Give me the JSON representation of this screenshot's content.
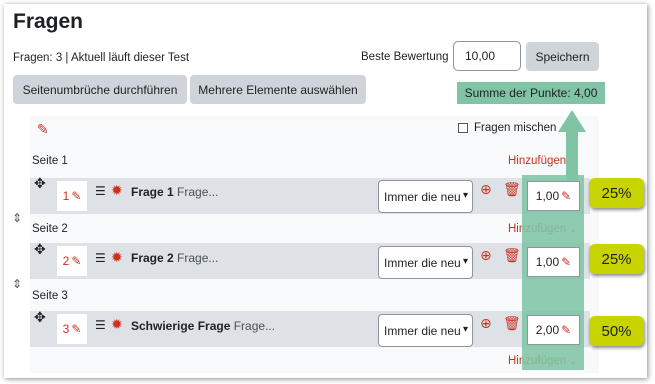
{
  "page": {
    "title": "Fragen",
    "info": "Fragen: 3 | Aktuell läuft dieser Test"
  },
  "grade": {
    "label": "Beste Bewertung",
    "value": "10,00",
    "save_label": "Speichern"
  },
  "toolbar": {
    "repaginate_label": "Seitenumbrüche durchführen",
    "multi_select_label": "Mehrere Elemente auswählen"
  },
  "sum": {
    "label": "Summe der Punkte: 4,00"
  },
  "shuffle": {
    "label": "Fragen mischen"
  },
  "add_label": "Hinzufügen",
  "pages": [
    {
      "label": "Seite 1",
      "question": {
        "number": "1",
        "name": "Frage 1",
        "text": "Frage...",
        "select": "Immer die neu",
        "mark": "1,00",
        "percent": "25%"
      }
    },
    {
      "label": "Seite 2",
      "question": {
        "number": "2",
        "name": "Frage 2",
        "text": "Frage...",
        "select": "Immer die neu",
        "mark": "1,00",
        "percent": "25%"
      }
    },
    {
      "label": "Seite 3",
      "question": {
        "number": "3",
        "name": "Schwierige Frage",
        "text": "Frage...",
        "select": "Immer die neu",
        "mark": "2,00",
        "percent": "50%"
      }
    }
  ],
  "colors": {
    "accent": "#ca3120",
    "highlight": "#80c4a5",
    "badge": "#c8d400"
  }
}
